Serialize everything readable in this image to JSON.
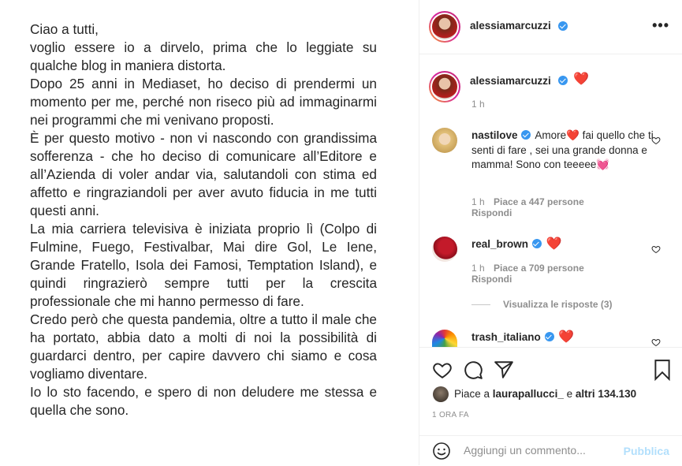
{
  "post": {
    "paragraphs": [
      "Ciao a tutti,",
      "voglio essere io a dirvelo, prima che lo leggiate su qualche blog in maniera distorta.",
      "Dopo 25 anni in Mediaset, ho deciso di prendermi un momento per me, perché non riseco più ad immaginarmi nei programmi che mi venivano proposti.",
      "È per questo motivo - non vi nascondo con grandissima sofferenza - che ho deciso di comunicare all’Editore e all’Azienda di voler andar via, salutandoli con stima ed affetto e ringraziandoli per aver avuto fiducia in me tutti questi anni.",
      "La mia carriera televisiva è iniziata proprio lì (Colpo di Fulmine, Fuego, Festivalbar, Mai dire Gol, Le Iene, Grande Fratello, Isola dei Famosi, Temptation Island), e quindi ringrazierò sempre tutti per la crescita professionale che mi hanno permesso di fare.",
      "Credo però che questa pandemia, oltre a tutto il male che ha portato, abbia dato a molti di noi la possibilità di guardarci dentro, per capire davvero chi siamo e cosa vogliamo diventare.",
      "Io lo sto facendo, e spero di non deludere me stessa e quella che sono."
    ]
  },
  "header": {
    "username": "alessiamarcuzzi",
    "more_icon": "more-dots-icon"
  },
  "caption": {
    "username": "alessiamarcuzzi",
    "emoji": "❤️",
    "time": "1 h"
  },
  "comments": [
    {
      "username": "nastilove",
      "text": "Amore❤️ fai quello che ti senti di fare , sei una grande donna e mamma! Sono con teeeee💓",
      "time": "1 h",
      "likes": "Piace a 447 persone",
      "reply": "Rispondi"
    },
    {
      "username": "real_brown",
      "text": "❤️",
      "time": "1 h",
      "likes": "Piace a 709 persone",
      "reply": "Rispondi",
      "view_replies": "Visualizza le risposte (3)"
    },
    {
      "username": "trash_italiano",
      "text": "❤️"
    }
  ],
  "actions": {
    "icons": [
      "heart-icon",
      "comment-icon",
      "share-icon",
      "bookmark-icon"
    ],
    "likes_prefix": "Piace a ",
    "likes_user": "laurapallucci_",
    "likes_mid": " e ",
    "likes_others": "altri 134.130",
    "time_ago": "1 ORA FA"
  },
  "comment_box": {
    "placeholder": "Aggiungi un commento...",
    "publish": "Pubblica",
    "emoji_icon": "smiley-icon"
  }
}
